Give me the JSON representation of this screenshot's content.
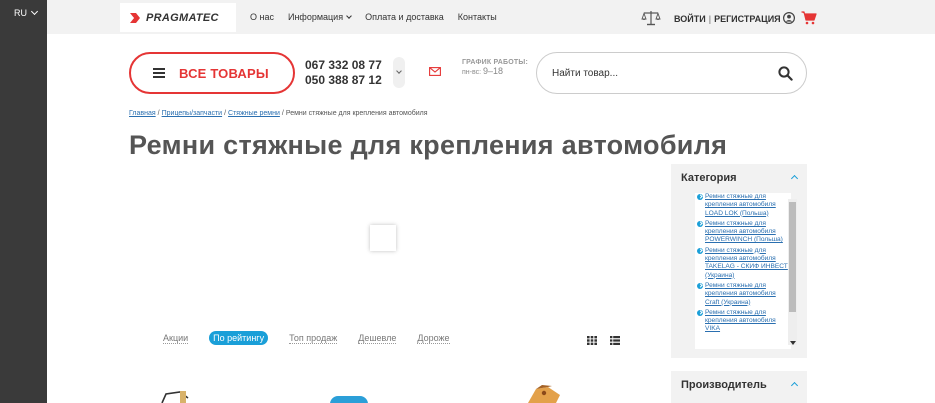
{
  "lang": {
    "current": "RU"
  },
  "logo": {
    "text": "PRAGMATEC"
  },
  "topnav": {
    "about": "О нас",
    "info": "Информация",
    "delivery": "Оплата и доставка",
    "contacts": "Контакты"
  },
  "auth": {
    "login": "ВОЙТИ",
    "separator": "|",
    "register": "РЕГИСТРАЦИЯ"
  },
  "header": {
    "all_goods": "ВСЕ ТОВАРЫ",
    "phone1": "067 332 08 77",
    "phone2": "050 388 87 12",
    "schedule_label": "ГРАФИК РАБОТЫ:",
    "schedule_days": "пн-вс:",
    "schedule_hours": "9–18"
  },
  "search": {
    "placeholder": "Найти товар..."
  },
  "breadcrumb": {
    "home": "Главная",
    "sep": "/",
    "trailers": "Прицепы/запчасти",
    "straps": "Стяжные ремни",
    "current": "Ремни стяжные для крепления автомобиля"
  },
  "page": {
    "title": "Ремни стяжные для крепления автомобиля"
  },
  "sort": {
    "options": [
      "Акции",
      "По рейтингу",
      "Топ продаж",
      "Дешевле",
      "Дороже"
    ],
    "active": "По рейтингу"
  },
  "filters": {
    "category": {
      "title": "Категория",
      "items": [
        "Ремни стяжные для крепления автомобиля LOAD LOK (Польша)",
        "Ремни стяжные для крепления автомобиля POWERWINCH (Польша)",
        "Ремни стяжные для крепления автомобиля TAKELAG - СКИФ ИНВЕСТ (Украина)",
        "Ремни стяжные для крепления автомобиля Craft (Украина)",
        "Ремни стяжные для крепления автомобиля VIKA"
      ]
    },
    "manufacturer": {
      "title": "Производитель"
    }
  },
  "colors": {
    "accent_red": "#e53535",
    "accent_blue": "#1a9fd8",
    "link": "#2a6fb0",
    "strip": "#3a3a3a"
  },
  "icons": [
    "chevron-down-icon",
    "scales-icon",
    "user-icon",
    "cart-icon",
    "menu-icon",
    "mail-icon",
    "search-icon",
    "grid-view-icon",
    "list-view-icon",
    "chevron-up-icon"
  ]
}
